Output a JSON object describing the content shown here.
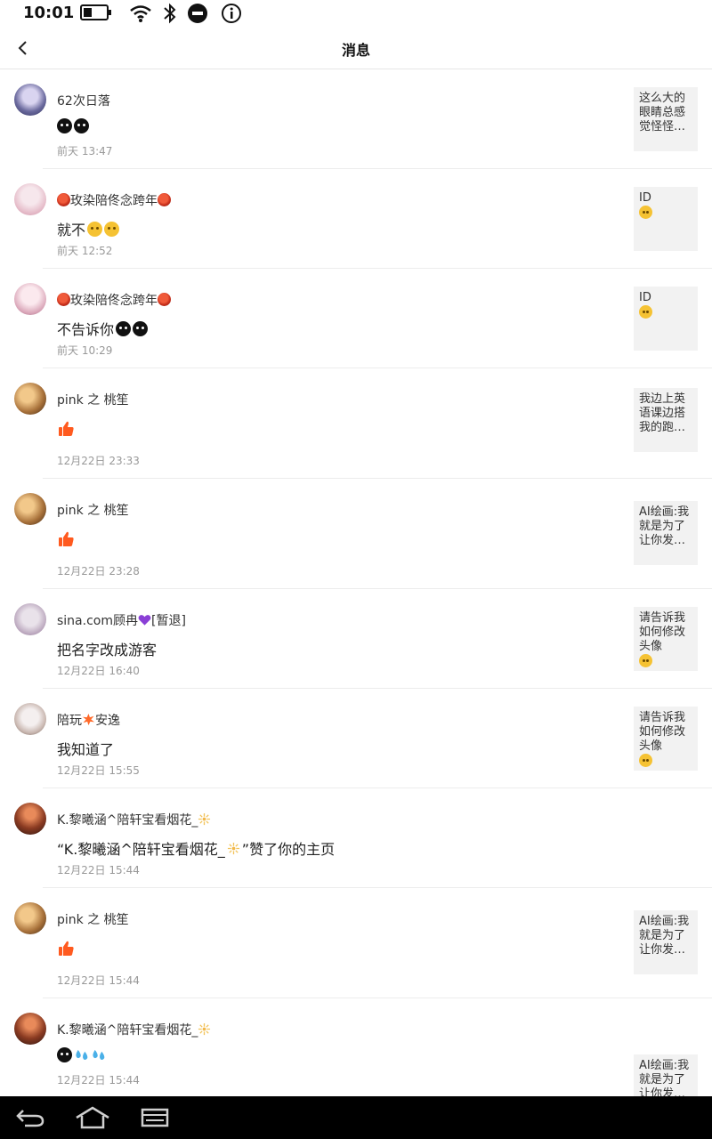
{
  "status_bar": {
    "time": "10:01"
  },
  "header": {
    "title": "消息"
  },
  "messages": [
    {
      "name": "62次日落",
      "text": "",
      "time": "前天 13:47",
      "preview": [
        "这么大的",
        "眼睛总感",
        "觉怪怪…"
      ]
    },
    {
      "name": "玫染陪佟念跨年",
      "text": "就不",
      "time": "前天 12:52",
      "preview": [
        "ID"
      ]
    },
    {
      "name": "玫染陪佟念跨年",
      "text": "不告诉你",
      "time": "前天 10:29",
      "preview": [
        "ID"
      ]
    },
    {
      "name": "pink 之 桃笙",
      "text": "",
      "time": "12月22日 23:33",
      "preview": [
        "我边上英",
        "语课边搭",
        "我的跑…"
      ]
    },
    {
      "name": "pink 之 桃笙",
      "text": "",
      "time": "12月22日 23:28",
      "preview": [
        "AI绘画:我",
        "就是为了",
        "让你发…"
      ]
    },
    {
      "name": "sina.com顾冉",
      "name_suffix": "[暂退]",
      "text": "把名字改成游客",
      "time": "12月22日 16:40",
      "preview": [
        "请告诉我",
        "如何修改",
        "头像"
      ]
    },
    {
      "name_a": "陪玩",
      "name_b": "安逸",
      "text": "我知道了",
      "time": "12月22日 15:55",
      "preview": [
        "请告诉我",
        "如何修改",
        "头像"
      ]
    },
    {
      "name": "K.黎曦涵^陪轩宝看烟花_",
      "text_a": "“K.黎曦涵^陪轩宝看烟花_",
      "text_b": "”赞了你的主页",
      "time": "12月22日 15:44"
    },
    {
      "name": "pink 之 桃笙",
      "text": "",
      "time": "12月22日 15:44",
      "preview": [
        "AI绘画:我",
        "就是为了",
        "让你发…"
      ]
    },
    {
      "name": "K.黎曦涵^陪轩宝看烟花_",
      "text": "",
      "time": "12月22日 15:44",
      "preview": [
        "AI绘画:我",
        "就是为了",
        "让你发…"
      ]
    }
  ],
  "colors": {
    "like_orange": "#ff5a1f",
    "divider": "#ececec",
    "time_gray": "#999999",
    "thumb_bg": "#f2f2f2"
  }
}
